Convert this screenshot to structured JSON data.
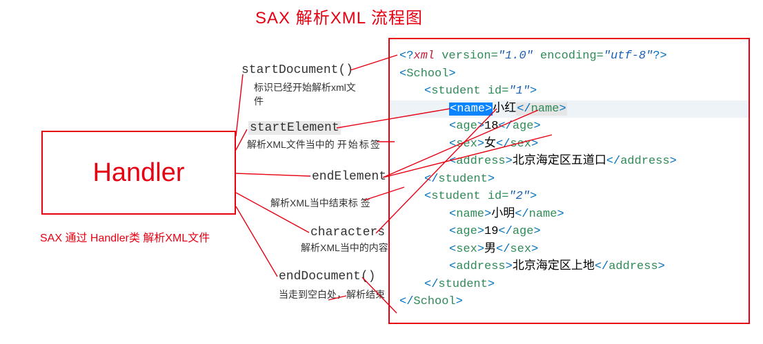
{
  "title": "SAX 解析XML 流程图",
  "handler": {
    "label": "Handler",
    "caption": "SAX 通过 Handler类 解析XML文件"
  },
  "callouts": {
    "startDocument": {
      "name": "startDocument()",
      "desc": "标识已经开始解析xml文件"
    },
    "startElement": {
      "name": "startElement",
      "desc_a": "解析XML文件当中的",
      "desc_b": "开始标签"
    },
    "endElement": {
      "name": "endElement",
      "desc": "解析XML当中结束标 签"
    },
    "characters": {
      "name": "characters",
      "desc": "解析XML当中的内容"
    },
    "endDocument": {
      "name": "endDocument()",
      "desc": "当走到空白处，解析结束"
    }
  },
  "xml": {
    "pi_pre": "<?",
    "pi_xml": "xml",
    "pi_version_k": " version=",
    "pi_version_v": "\"1.0\"",
    "pi_encoding_k": " encoding=",
    "pi_encoding_v": "\"utf-8\"",
    "pi_post": "?>",
    "root_open": "School",
    "student_tag": "student",
    "id_attr": "id",
    "students": [
      {
        "id": "\"1\"",
        "name": "小红",
        "age": "18",
        "sex": "女",
        "address": "北京海定区五道口"
      },
      {
        "id": "\"2\"",
        "name": "小明",
        "age": "19",
        "sex": "男",
        "address": "北京海定区上地"
      }
    ],
    "tags": {
      "name": "name",
      "age": "age",
      "sex": "sex",
      "address": "address"
    }
  }
}
